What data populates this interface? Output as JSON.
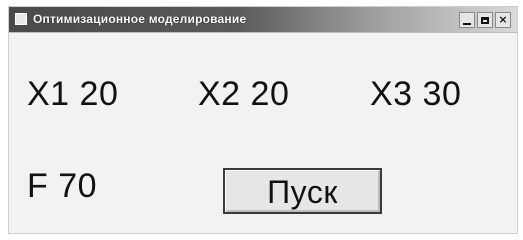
{
  "window": {
    "title": "Оптимизационное моделирование",
    "controls": {
      "minimize_icon": "minimize-icon",
      "maximize_icon": "maximize-icon",
      "close_icon": "close-icon"
    }
  },
  "fields": {
    "x1": {
      "label": "X1",
      "value": "20"
    },
    "x2": {
      "label": "X2",
      "value": "20"
    },
    "x3": {
      "label": "X3",
      "value": "30"
    },
    "f": {
      "label": "F",
      "value": "70"
    }
  },
  "actions": {
    "run_label": "Пуск"
  }
}
